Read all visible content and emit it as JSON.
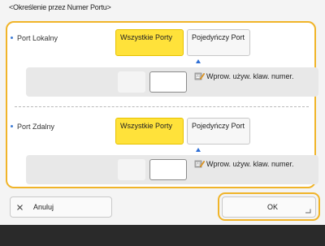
{
  "screen": {
    "title": "<Określenie przez Numer Portu>"
  },
  "local_port": {
    "label": "Port Lokalny",
    "option_all": "Wszystkie Porty",
    "option_single": "Pojedyńczy Port",
    "selected": "all",
    "input_value": "",
    "hint": "Wprow. używ. klaw. numer."
  },
  "remote_port": {
    "label": "Port Zdalny",
    "option_all": "Wszystkie Porty",
    "option_single": "Pojedyńczy Port",
    "selected": "all",
    "input_value": "",
    "hint": "Wprow. używ. klaw. numer."
  },
  "footer": {
    "cancel_label": "Anuluj",
    "ok_label": "OK"
  },
  "colors": {
    "selected_fill": "#ffe23a",
    "focus_border": "#f0b429",
    "arrow_blue": "#2f6fd6"
  }
}
